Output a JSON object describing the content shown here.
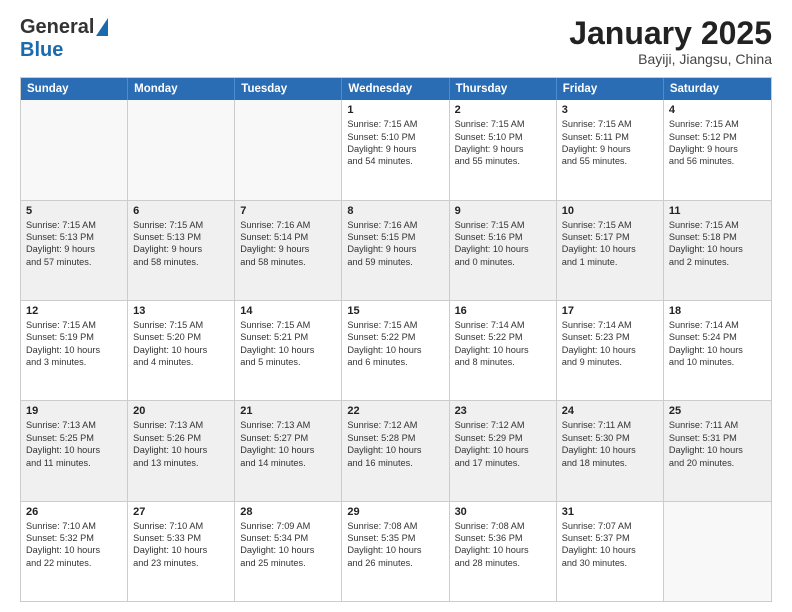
{
  "header": {
    "logo_general": "General",
    "logo_blue": "Blue",
    "month_title": "January 2025",
    "subtitle": "Bayiji, Jiangsu, China"
  },
  "weekdays": [
    "Sunday",
    "Monday",
    "Tuesday",
    "Wednesday",
    "Thursday",
    "Friday",
    "Saturday"
  ],
  "rows": [
    [
      {
        "day": "",
        "info": ""
      },
      {
        "day": "",
        "info": ""
      },
      {
        "day": "",
        "info": ""
      },
      {
        "day": "1",
        "info": "Sunrise: 7:15 AM\nSunset: 5:10 PM\nDaylight: 9 hours\nand 54 minutes."
      },
      {
        "day": "2",
        "info": "Sunrise: 7:15 AM\nSunset: 5:10 PM\nDaylight: 9 hours\nand 55 minutes."
      },
      {
        "day": "3",
        "info": "Sunrise: 7:15 AM\nSunset: 5:11 PM\nDaylight: 9 hours\nand 55 minutes."
      },
      {
        "day": "4",
        "info": "Sunrise: 7:15 AM\nSunset: 5:12 PM\nDaylight: 9 hours\nand 56 minutes."
      }
    ],
    [
      {
        "day": "5",
        "info": "Sunrise: 7:15 AM\nSunset: 5:13 PM\nDaylight: 9 hours\nand 57 minutes."
      },
      {
        "day": "6",
        "info": "Sunrise: 7:15 AM\nSunset: 5:13 PM\nDaylight: 9 hours\nand 58 minutes."
      },
      {
        "day": "7",
        "info": "Sunrise: 7:16 AM\nSunset: 5:14 PM\nDaylight: 9 hours\nand 58 minutes."
      },
      {
        "day": "8",
        "info": "Sunrise: 7:16 AM\nSunset: 5:15 PM\nDaylight: 9 hours\nand 59 minutes."
      },
      {
        "day": "9",
        "info": "Sunrise: 7:15 AM\nSunset: 5:16 PM\nDaylight: 10 hours\nand 0 minutes."
      },
      {
        "day": "10",
        "info": "Sunrise: 7:15 AM\nSunset: 5:17 PM\nDaylight: 10 hours\nand 1 minute."
      },
      {
        "day": "11",
        "info": "Sunrise: 7:15 AM\nSunset: 5:18 PM\nDaylight: 10 hours\nand 2 minutes."
      }
    ],
    [
      {
        "day": "12",
        "info": "Sunrise: 7:15 AM\nSunset: 5:19 PM\nDaylight: 10 hours\nand 3 minutes."
      },
      {
        "day": "13",
        "info": "Sunrise: 7:15 AM\nSunset: 5:20 PM\nDaylight: 10 hours\nand 4 minutes."
      },
      {
        "day": "14",
        "info": "Sunrise: 7:15 AM\nSunset: 5:21 PM\nDaylight: 10 hours\nand 5 minutes."
      },
      {
        "day": "15",
        "info": "Sunrise: 7:15 AM\nSunset: 5:22 PM\nDaylight: 10 hours\nand 6 minutes."
      },
      {
        "day": "16",
        "info": "Sunrise: 7:14 AM\nSunset: 5:22 PM\nDaylight: 10 hours\nand 8 minutes."
      },
      {
        "day": "17",
        "info": "Sunrise: 7:14 AM\nSunset: 5:23 PM\nDaylight: 10 hours\nand 9 minutes."
      },
      {
        "day": "18",
        "info": "Sunrise: 7:14 AM\nSunset: 5:24 PM\nDaylight: 10 hours\nand 10 minutes."
      }
    ],
    [
      {
        "day": "19",
        "info": "Sunrise: 7:13 AM\nSunset: 5:25 PM\nDaylight: 10 hours\nand 11 minutes."
      },
      {
        "day": "20",
        "info": "Sunrise: 7:13 AM\nSunset: 5:26 PM\nDaylight: 10 hours\nand 13 minutes."
      },
      {
        "day": "21",
        "info": "Sunrise: 7:13 AM\nSunset: 5:27 PM\nDaylight: 10 hours\nand 14 minutes."
      },
      {
        "day": "22",
        "info": "Sunrise: 7:12 AM\nSunset: 5:28 PM\nDaylight: 10 hours\nand 16 minutes."
      },
      {
        "day": "23",
        "info": "Sunrise: 7:12 AM\nSunset: 5:29 PM\nDaylight: 10 hours\nand 17 minutes."
      },
      {
        "day": "24",
        "info": "Sunrise: 7:11 AM\nSunset: 5:30 PM\nDaylight: 10 hours\nand 18 minutes."
      },
      {
        "day": "25",
        "info": "Sunrise: 7:11 AM\nSunset: 5:31 PM\nDaylight: 10 hours\nand 20 minutes."
      }
    ],
    [
      {
        "day": "26",
        "info": "Sunrise: 7:10 AM\nSunset: 5:32 PM\nDaylight: 10 hours\nand 22 minutes."
      },
      {
        "day": "27",
        "info": "Sunrise: 7:10 AM\nSunset: 5:33 PM\nDaylight: 10 hours\nand 23 minutes."
      },
      {
        "day": "28",
        "info": "Sunrise: 7:09 AM\nSunset: 5:34 PM\nDaylight: 10 hours\nand 25 minutes."
      },
      {
        "day": "29",
        "info": "Sunrise: 7:08 AM\nSunset: 5:35 PM\nDaylight: 10 hours\nand 26 minutes."
      },
      {
        "day": "30",
        "info": "Sunrise: 7:08 AM\nSunset: 5:36 PM\nDaylight: 10 hours\nand 28 minutes."
      },
      {
        "day": "31",
        "info": "Sunrise: 7:07 AM\nSunset: 5:37 PM\nDaylight: 10 hours\nand 30 minutes."
      },
      {
        "day": "",
        "info": ""
      }
    ]
  ]
}
